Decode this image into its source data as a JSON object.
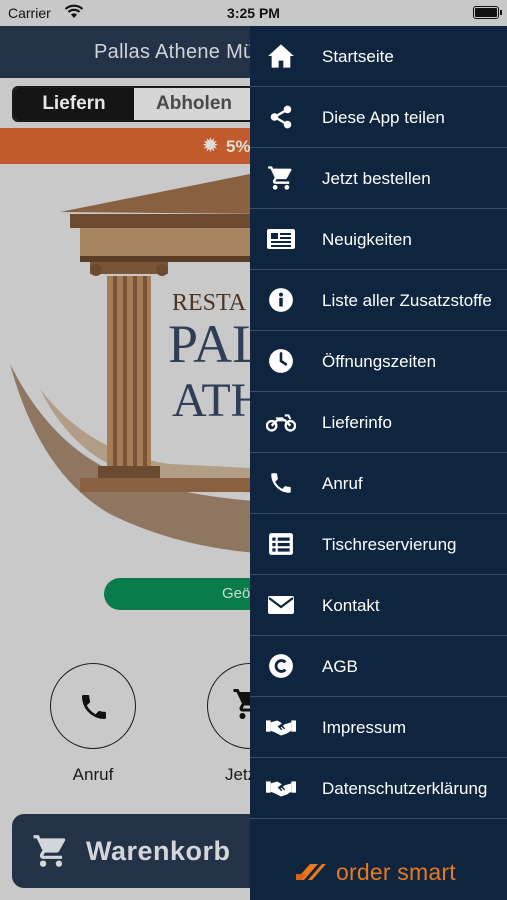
{
  "status_bar": {
    "carrier": "Carrier",
    "time": "3:25 PM"
  },
  "app": {
    "header_title": "Pallas Athene Mün",
    "tabs": [
      {
        "label": "Liefern",
        "selected": true
      },
      {
        "label": "Abholen",
        "selected": false
      }
    ],
    "promo_text": "5%",
    "hero": {
      "line1": "RESTA",
      "line2": "PAL",
      "line3": "ATHE"
    },
    "open_status": "Geö",
    "actions": [
      {
        "label": "Anruf",
        "icon": "phone-icon"
      },
      {
        "label": "Jetzt b",
        "icon": "cart-icon"
      }
    ],
    "cart_button": "Warenkorb"
  },
  "drawer": {
    "items": [
      {
        "label": "Startseite",
        "icon": "home-icon"
      },
      {
        "label": "Diese App teilen",
        "icon": "share-icon"
      },
      {
        "label": "Jetzt bestellen",
        "icon": "cart-icon"
      },
      {
        "label": "Neuigkeiten",
        "icon": "newspaper-icon"
      },
      {
        "label": "Liste aller Zusatzstoffe",
        "icon": "info-icon"
      },
      {
        "label": "Öffnungszeiten",
        "icon": "clock-icon"
      },
      {
        "label": "Lieferinfo",
        "icon": "motorcycle-icon"
      },
      {
        "label": "Anruf",
        "icon": "phone-icon"
      },
      {
        "label": "Tischreservierung",
        "icon": "list-icon"
      },
      {
        "label": "Kontakt",
        "icon": "envelope-icon"
      },
      {
        "label": "AGB",
        "icon": "copyright-icon"
      },
      {
        "label": "Impressum",
        "icon": "handshake-icon"
      },
      {
        "label": "Datenschutzerklärung",
        "icon": "handshake-icon"
      }
    ],
    "brand": "order smart"
  },
  "colors": {
    "drawer_bg": "#0f243f",
    "header_bg": "#233247",
    "promo": "#c15a2d",
    "open_green": "#0a7c4b",
    "brand_orange": "#e8791e"
  }
}
